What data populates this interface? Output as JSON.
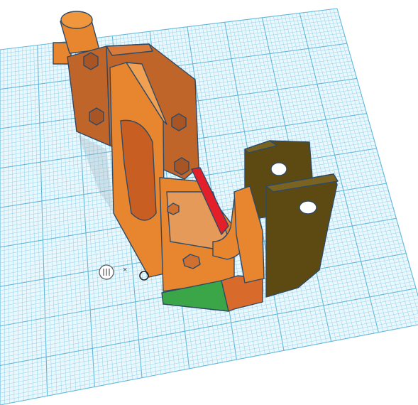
{
  "workplane": {
    "grid_visible": true,
    "grid_color": "#8fd3ec",
    "grid_major_color": "#5fb8da",
    "background": "#ffffff"
  },
  "ruler": {
    "icon": "ruler-origin-icon",
    "close_label": "×"
  },
  "model": {
    "colors": {
      "main": "#e8862f",
      "main_dark": "#c0652a",
      "main_side": "#b55a26",
      "holder": "#5c4a12",
      "holder_dark": "#3e3210",
      "highlight_red": "#e3202a",
      "highlight_green": "#3aa648",
      "outline": "#2e4a66"
    }
  }
}
